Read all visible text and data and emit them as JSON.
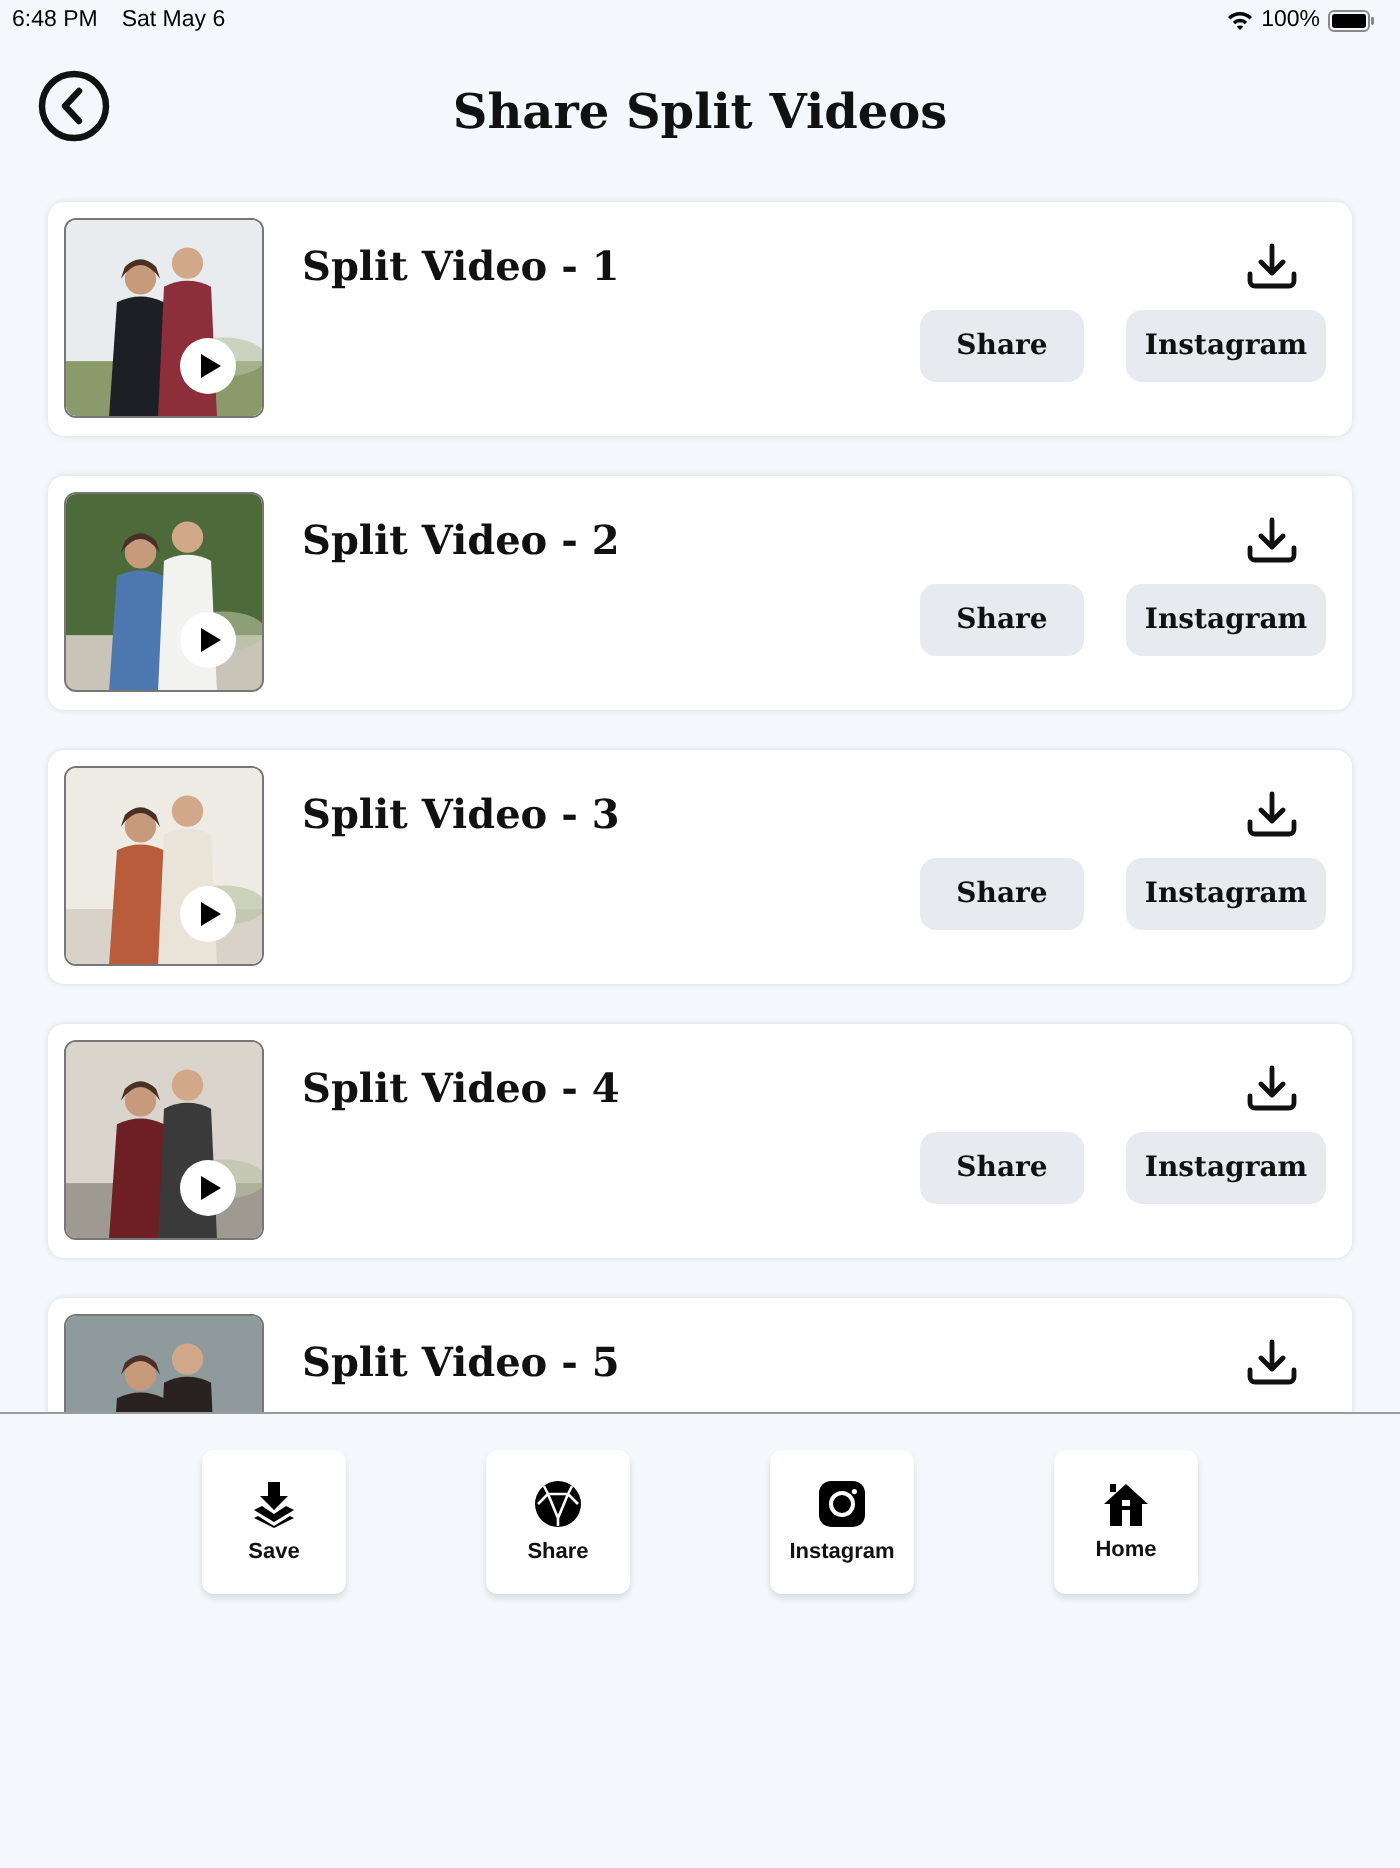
{
  "status_bar": {
    "time": "6:48 PM",
    "date": "Sat May 6",
    "battery": "100%"
  },
  "header": {
    "title": "Share Split Videos"
  },
  "videos": [
    {
      "title": "Split Video - 1",
      "play_button": true,
      "buttons": [
        "Share",
        "Instagram"
      ]
    },
    {
      "title": "Split Video - 2",
      "play_button": true,
      "buttons": [
        "Share",
        "Instagram"
      ]
    },
    {
      "title": "Split Video - 3",
      "play_button": true,
      "buttons": [
        "Share",
        "Instagram"
      ]
    },
    {
      "title": "Split Video - 4",
      "play_button": true,
      "buttons": [
        "Share",
        "Instagram"
      ]
    },
    {
      "title": "Split Video - 5"
    }
  ],
  "bottom_bar": [
    {
      "kind": "save",
      "label": "Save"
    },
    {
      "kind": "share",
      "label": "Share"
    },
    {
      "kind": "instagram",
      "label": "Instagram"
    },
    {
      "kind": "home",
      "label": "Home"
    }
  ]
}
